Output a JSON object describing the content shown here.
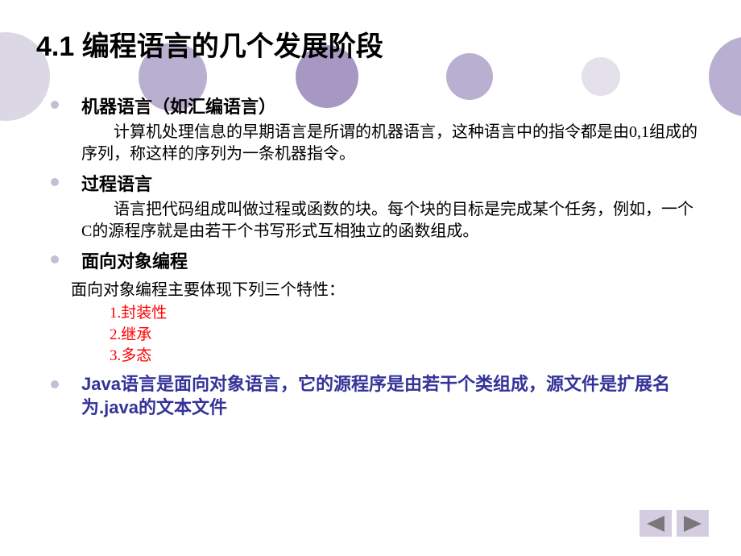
{
  "title": "4.1 编程语言的几个发展阶段",
  "items": [
    {
      "title": "机器语言（如汇编语言）",
      "desc": "计算机处理信息的早期语言是所谓的机器语言，这种语言中的指令都是由0,1组成的序列，称这样的序列为一条机器指令。"
    },
    {
      "title": "过程语言",
      "desc": "语言把代码组成叫做过程或函数的块。每个块的目标是完成某个任务，例如，一个C的源程序就是由若干个书写形式互相独立的函数组成。"
    },
    {
      "title": "面向对象编程",
      "sub": "面向对象编程主要体现下列三个特性：",
      "features": [
        "1.封装性",
        "2.继承",
        "3.多态"
      ]
    }
  ],
  "java": {
    "prefix": "Java",
    "mid1": "语言是面向对象语言，它的源程序是由若干个类组成，源文件是扩展名为",
    "ext": ".java",
    "suffix": "的文本文件"
  }
}
